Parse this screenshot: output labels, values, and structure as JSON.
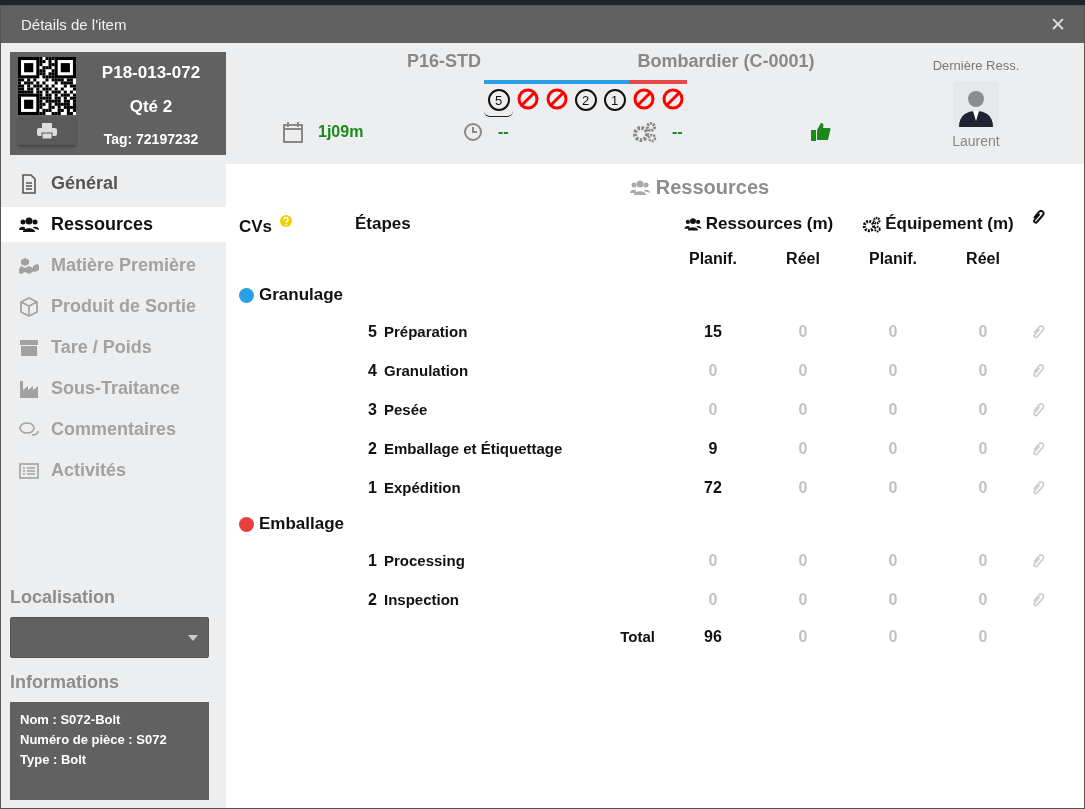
{
  "window": {
    "title": "Détails de l'item",
    "close": "✕"
  },
  "item_card": {
    "code": "P18-013-072",
    "quantity": "Qté 2",
    "tag": "Tag: 72197232"
  },
  "sidebar": {
    "items": [
      {
        "label": "Général",
        "selected": false,
        "disabled": false
      },
      {
        "label": "Ressources",
        "selected": true,
        "disabled": false
      },
      {
        "label": "Matière Première",
        "selected": false,
        "disabled": true
      },
      {
        "label": "Produit de Sortie",
        "selected": false,
        "disabled": true
      },
      {
        "label": "Tare / Poids",
        "selected": false,
        "disabled": true
      },
      {
        "label": "Sous-Traitance",
        "selected": false,
        "disabled": true
      },
      {
        "label": "Commentaires",
        "selected": false,
        "disabled": true
      },
      {
        "label": "Activités",
        "selected": false,
        "disabled": true
      }
    ]
  },
  "location": {
    "label": "Localisation"
  },
  "informations": {
    "label": "Informations",
    "lines": [
      "Nom : S072-Bolt",
      "Numéro de pièce : S072",
      "Type : Bolt"
    ]
  },
  "header": {
    "product": "P16-STD",
    "customer": "Bombardier (C-0001)",
    "step_groups": [
      {
        "color": "#2a9fe6",
        "steps": [
          {
            "kind": "number",
            "text": "5",
            "selected": true
          },
          {
            "kind": "blocked",
            "selected": false
          },
          {
            "kind": "blocked",
            "selected": false
          },
          {
            "kind": "number",
            "text": "2",
            "selected": false
          },
          {
            "kind": "number",
            "text": "1",
            "selected": false
          }
        ]
      },
      {
        "color": "#e84a4a",
        "steps": [
          {
            "kind": "blocked",
            "selected": false
          },
          {
            "kind": "blocked",
            "selected": false
          }
        ]
      }
    ],
    "stats": [
      "1j09m",
      "--",
      "--"
    ],
    "last_resource": {
      "label": "Dernière Ress.",
      "name": "Laurent"
    }
  },
  "section_title": "Ressources",
  "table": {
    "columns": {
      "cvs": "CVs",
      "steps": "Étapes",
      "resources": "Ressources (m)",
      "equipment": "Équipement (m)",
      "sub": [
        "Planif.",
        "Réel",
        "Planif.",
        "Réel"
      ]
    },
    "groups": [
      {
        "name": "Granulage",
        "color": "#2a9fe6",
        "rows": [
          {
            "number": "5",
            "name": "Préparation",
            "values": [
              {
                "text": "15",
                "dim": false
              },
              {
                "text": "0",
                "dim": true
              },
              {
                "text": "0",
                "dim": true
              },
              {
                "text": "0",
                "dim": true
              }
            ]
          },
          {
            "number": "4",
            "name": "Granulation",
            "values": [
              {
                "text": "0",
                "dim": true
              },
              {
                "text": "0",
                "dim": true
              },
              {
                "text": "0",
                "dim": true
              },
              {
                "text": "0",
                "dim": true
              }
            ]
          },
          {
            "number": "3",
            "name": "Pesée",
            "values": [
              {
                "text": "0",
                "dim": true
              },
              {
                "text": "0",
                "dim": true
              },
              {
                "text": "0",
                "dim": true
              },
              {
                "text": "0",
                "dim": true
              }
            ]
          },
          {
            "number": "2",
            "name": "Emballage et Étiquettage",
            "values": [
              {
                "text": "9",
                "dim": false
              },
              {
                "text": "0",
                "dim": true
              },
              {
                "text": "0",
                "dim": true
              },
              {
                "text": "0",
                "dim": true
              }
            ]
          },
          {
            "number": "1",
            "name": "Expédition",
            "values": [
              {
                "text": "72",
                "dim": false
              },
              {
                "text": "0",
                "dim": true
              },
              {
                "text": "0",
                "dim": true
              },
              {
                "text": "0",
                "dim": true
              }
            ]
          }
        ]
      },
      {
        "name": "Emballage",
        "color": "#e83e3e",
        "rows": [
          {
            "number": "1",
            "name": "Processing",
            "values": [
              {
                "text": "0",
                "dim": true
              },
              {
                "text": "0",
                "dim": true
              },
              {
                "text": "0",
                "dim": true
              },
              {
                "text": "0",
                "dim": true
              }
            ]
          },
          {
            "number": "2",
            "name": "Inspection",
            "values": [
              {
                "text": "0",
                "dim": true
              },
              {
                "text": "0",
                "dim": true
              },
              {
                "text": "0",
                "dim": true
              },
              {
                "text": "0",
                "dim": true
              }
            ]
          }
        ]
      }
    ],
    "total": {
      "label": "Total",
      "values": [
        {
          "text": "96",
          "dim": false
        },
        {
          "text": "0",
          "dim": true
        },
        {
          "text": "0",
          "dim": true
        },
        {
          "text": "0",
          "dim": true
        }
      ]
    }
  }
}
